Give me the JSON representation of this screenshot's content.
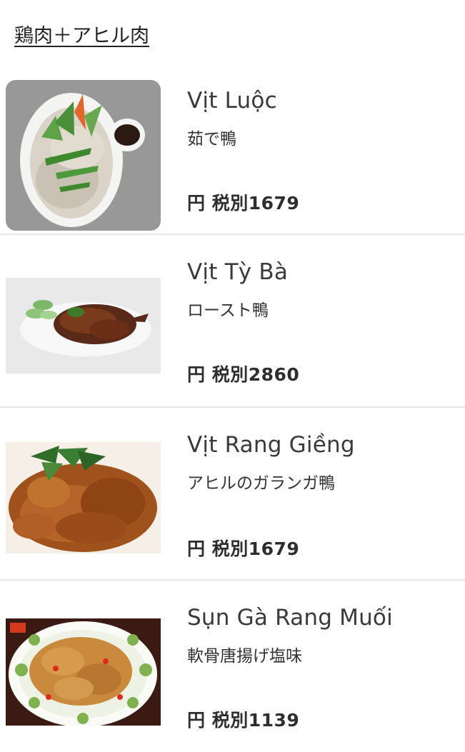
{
  "section": {
    "title": "鶏肉＋アヒル肉"
  },
  "items": [
    {
      "name": "Vịt Luộc",
      "subname": "茹で鴨",
      "price": "円 税別1679",
      "image_icon": "boiled-duck-photo"
    },
    {
      "name": "Vịt Tỳ Bà",
      "subname": "ロースト鴨",
      "price": "円 税別2860",
      "image_icon": "roast-duck-photo"
    },
    {
      "name": "Vịt Rang Giềng",
      "subname": "アヒルのガランガ鴨",
      "price": "円 税別1679",
      "image_icon": "galangal-duck-photo"
    },
    {
      "name": "Sụn Gà Rang Muối",
      "subname": "軟骨唐揚げ塩味",
      "price": "円 税別1139",
      "image_icon": "salted-cartilage-photo"
    }
  ]
}
